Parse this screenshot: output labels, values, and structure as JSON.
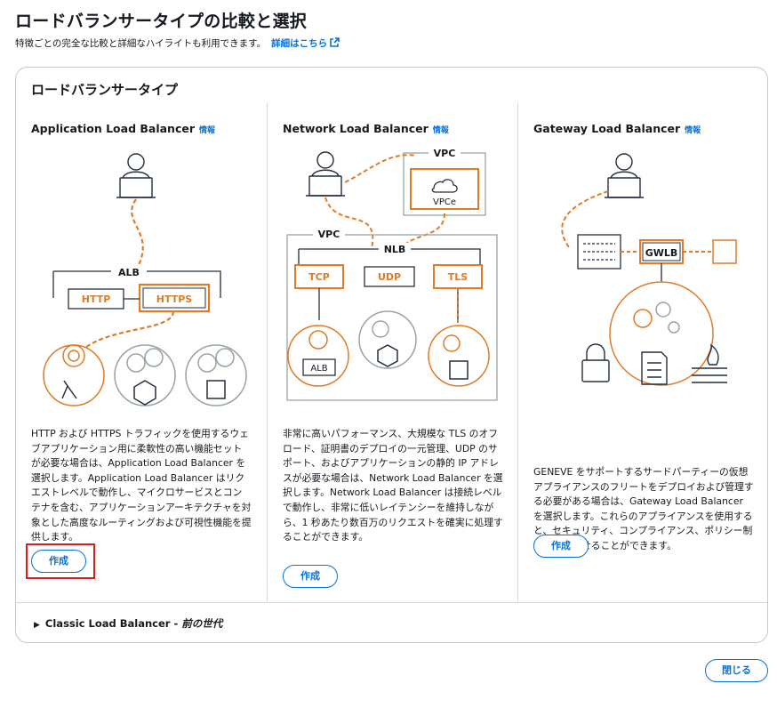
{
  "header": {
    "title": "ロードバランサータイプの比較と選択",
    "description": "特徴ごとの完全な比較と詳細なハイライトも利用できます。",
    "details_link": "詳細はこちら"
  },
  "panel": {
    "title": "ロードバランサータイプ",
    "columns": [
      {
        "title": "Application Load Balancer",
        "info": "情報",
        "diagram": {
          "group": "ALB",
          "listeners": [
            "HTTP",
            "HTTPS"
          ]
        },
        "description": "HTTP および HTTPS トラフィックを使用するウェブアプリケーション用に柔軟性の高い機能セットが必要な場合は、Application Load Balancer を選択します。Application Load Balancer はリクエストレベルで動作し、マイクロサービスとコンテナを含む、アプリケーションアーキテクチャを対象とした高度なルーティングおよび可視性機能を提供します。",
        "button": "作成"
      },
      {
        "title": "Network Load Balancer",
        "info": "情報",
        "diagram": {
          "vpc_top": "VPC",
          "vpce": "VPCe",
          "vpc": "VPC",
          "group": "NLB",
          "listeners": [
            "TCP",
            "UDP",
            "TLS"
          ],
          "target": "ALB"
        },
        "description": "非常に高いパフォーマンス、大規模な TLS のオフロード、証明書のデプロイの一元管理、UDP のサポート、およびアプリケーションの静的 IP アドレスが必要な場合は、Network Load Balancer を選択します。Network Load Balancer は接続レベルで動作し、非常に低いレイテンシーを維持しながら、1 秒あたり数百万のリクエストを確実に処理することができます。",
        "button": "作成"
      },
      {
        "title": "Gateway Load Balancer",
        "info": "情報",
        "diagram": {
          "group": "GWLB"
        },
        "description": "GENEVE をサポートするサードパーティーの仮想アプライアンスのフリートをデプロイおよび管理する必要がある場合は、Gateway Load Balancer を選択します。これらのアプライアンスを使用すると、セキュリティ、コンプライアンス、ポリシー制御を向上させることができます。",
        "button": "作成"
      }
    ],
    "classic": {
      "label": "Classic Load Balancer - ",
      "suffix": "前の世代"
    }
  },
  "footer": {
    "close": "閉じる"
  },
  "colors": {
    "accent": "#0972d3",
    "orange": "#e07b26",
    "highlight": "#d81e1e",
    "text": "#16191f"
  }
}
